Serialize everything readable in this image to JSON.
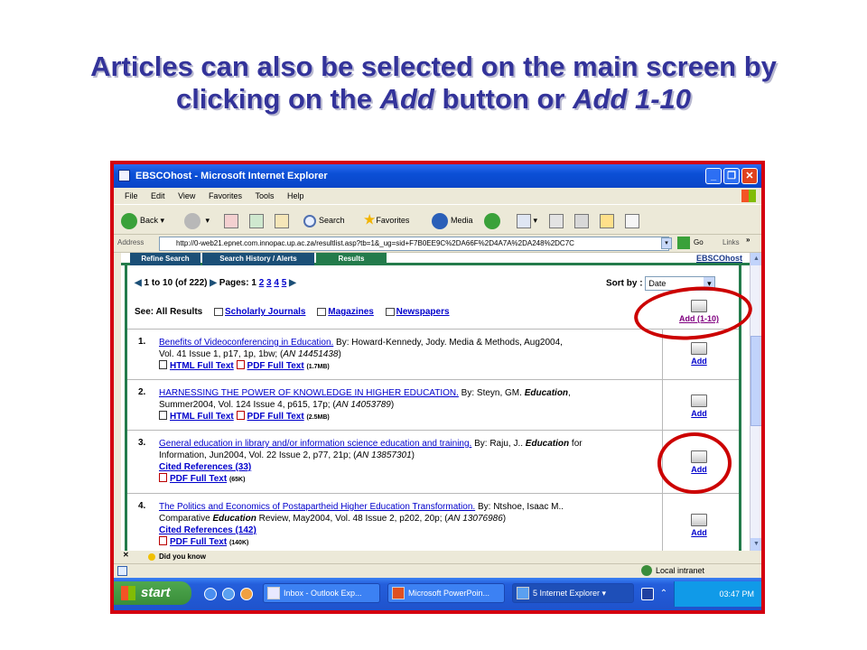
{
  "slide": {
    "title_line1": "Articles can also be selected on the main screen by",
    "title_line2_prefix": "clicking on the ",
    "title_add": "Add",
    "title_mid": " button or ",
    "title_add110": "Add 1-10"
  },
  "window": {
    "title": "EBSCOhost - Microsoft Internet Explorer",
    "menu": [
      "File",
      "Edit",
      "View",
      "Favorites",
      "Tools",
      "Help"
    ],
    "toolbar": {
      "back": "Back",
      "search": "Search",
      "favorites": "Favorites",
      "media": "Media"
    },
    "address_label": "Address",
    "address_value": "http://0-web21.epnet.com.innopac.up.ac.za/resultlist.asp?tb=1&_ug=sid+F7B0EE9C%2DA66F%2D4A7A%2DA248%2DC7C",
    "go": "Go",
    "links": "Links"
  },
  "page": {
    "tabs": [
      "Refine Search",
      "Search History / Alerts",
      "Results"
    ],
    "brand": "EBSCOhost",
    "pager": {
      "range": "1 to 10",
      "total": "(of 222)",
      "pages_label": "Pages: 1",
      "pages": [
        "2",
        "3",
        "4",
        "5"
      ]
    },
    "sort_label": "Sort by :",
    "sort_value": "Date",
    "see_all": "See: All Results",
    "categories": [
      "Scholarly Journals",
      "Magazines",
      "Newspapers"
    ],
    "add_all": "Add (1-10)",
    "add": "Add",
    "results": [
      {
        "num": "1.",
        "title": "Benefits of Videoconferencing in Education.",
        "by": " By: Howard-Kennedy, Jody. Media & Methods, Aug2004,",
        "line2": "Vol. 41 Issue 1, p17, 1p, 1bw; (",
        "an": "AN 14451438",
        "html": "HTML Full Text",
        "pdf": "PDF Full Text",
        "size": "(1.7MB)"
      },
      {
        "num": "2.",
        "title": "HARNESSING THE POWER OF KNOWLEDGE IN HIGHER EDUCATION.",
        "by": " By: Steyn, GM.",
        "journal": "Education",
        "line2": "Summer2004, Vol. 124 Issue 4, p615, 17p; (",
        "an": "AN 14053789",
        "html": "HTML Full Text",
        "pdf": "PDF Full Text",
        "size": "(2.5MB)"
      },
      {
        "num": "3.",
        "title": "General education in library and/or information science education and training.",
        "by": " By: Raju, J..",
        "journal": "Education",
        "by_after": " for",
        "line2": "Information, Jun2004, Vol. 22 Issue 2, p77, 21p; (",
        "an": "AN 13857301",
        "cited": "Cited References (33)",
        "pdf": "PDF Full Text",
        "size": "(65K)"
      },
      {
        "num": "4.",
        "title": "The Politics and Economics of Postapartheid Higher Education Transformation.",
        "by": " By: Ntshoe, Isaac M..",
        "line2_pre": "Comparative ",
        "journal": "Education",
        "line2": " Review, May2004, Vol. 48 Issue 2, p202, 20p; (",
        "an": "AN 13076986",
        "cited": "Cited References (142)",
        "pdf": "PDF Full Text",
        "size": "(140K)"
      }
    ],
    "did_you_know": "Did you know"
  },
  "status": {
    "zone": "Local intranet"
  },
  "taskbar": {
    "start": "start",
    "tasks": [
      "Inbox - Outlook Exp...",
      "Microsoft PowerPoin...",
      "5 Internet Explorer"
    ],
    "clock": "03:47 PM"
  }
}
